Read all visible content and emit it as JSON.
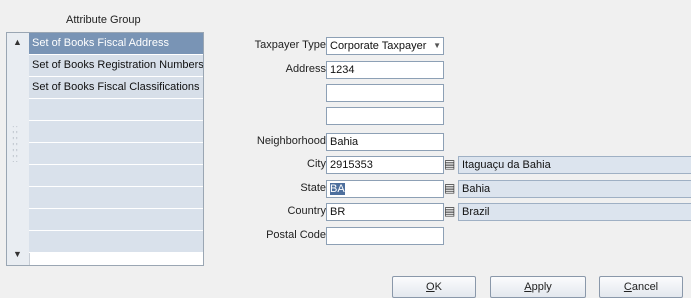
{
  "attribute_group": {
    "title": "Attribute Group",
    "items": [
      {
        "label": "Set of Books Fiscal Address",
        "selected": true
      },
      {
        "label": "Set of Books Registration Numbers",
        "selected": false
      },
      {
        "label": "Set of Books Fiscal Classifications",
        "selected": false
      },
      {
        "label": "",
        "selected": false
      },
      {
        "label": "",
        "selected": false
      },
      {
        "label": "",
        "selected": false
      },
      {
        "label": "",
        "selected": false
      },
      {
        "label": "",
        "selected": false
      },
      {
        "label": "",
        "selected": false
      },
      {
        "label": "",
        "selected": false
      }
    ],
    "scroll_up_icon": "triangle-up",
    "scroll_down_icon": "triangle-down"
  },
  "form": {
    "taxpayer_type": {
      "label": "Taxpayer Type",
      "value": "Corporate Taxpayer"
    },
    "address": {
      "label": "Address",
      "line1": "1234",
      "line2": "",
      "line3": ""
    },
    "neighborhood": {
      "label": "Neighborhood",
      "value": "Bahia"
    },
    "city": {
      "label": "City",
      "value": "2915353",
      "description": "Itaguaçu da Bahia"
    },
    "state": {
      "label": "State",
      "value": "BA",
      "description": "Bahia"
    },
    "country": {
      "label": "Country",
      "value": "BR",
      "description": "Brazil"
    },
    "postal_code": {
      "label": "Postal Code",
      "value": ""
    }
  },
  "buttons": {
    "ok": {
      "mnemonic": "O",
      "rest": "K"
    },
    "apply": {
      "mnemonic": "A",
      "rest": "pply"
    },
    "cancel": {
      "mnemonic": "C",
      "rest": "ancel"
    }
  },
  "colors": {
    "selected_item": "#7994b5",
    "list_item": "#d7dfe9",
    "description_field": "#dce4ee"
  }
}
